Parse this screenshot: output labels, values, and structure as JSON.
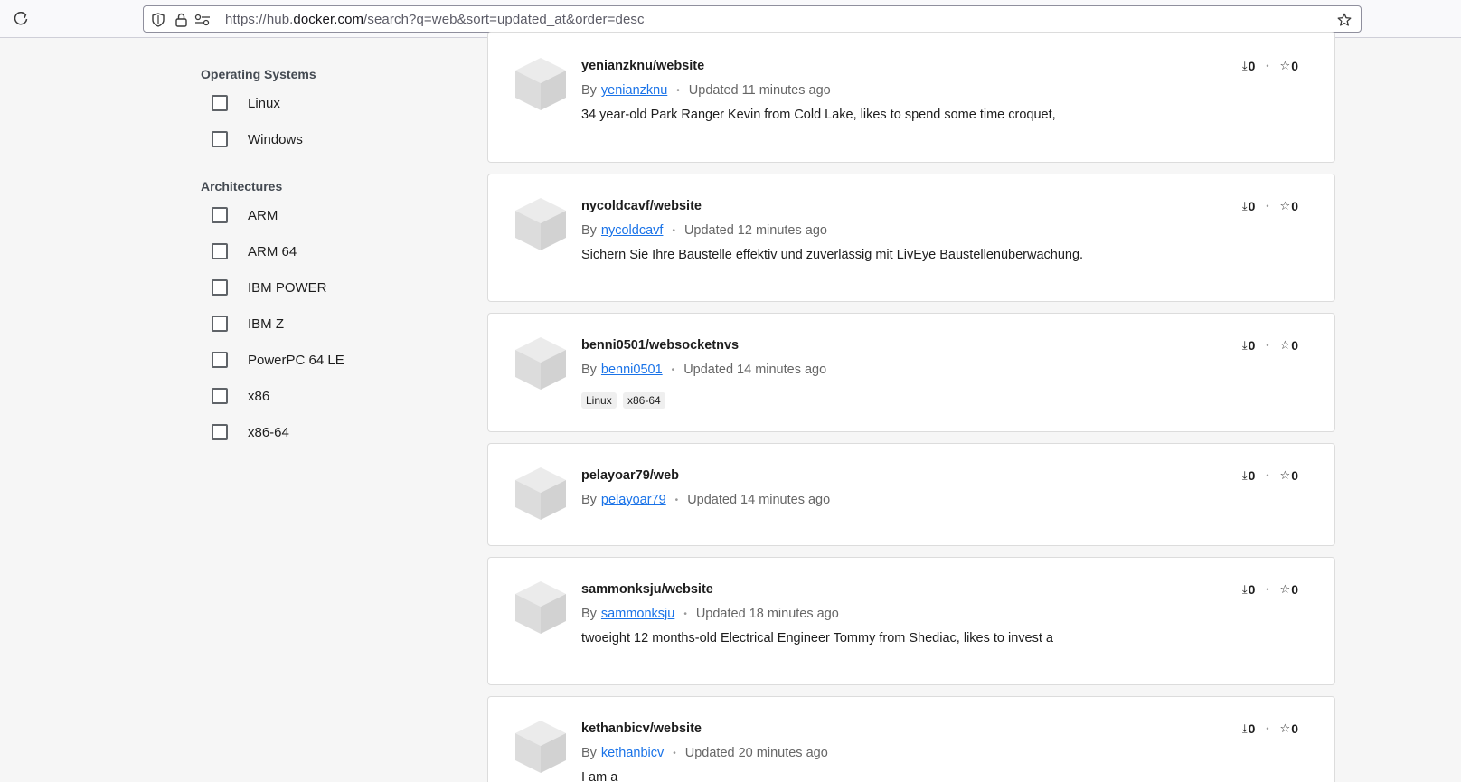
{
  "browser": {
    "url_prefix": "https://hub.",
    "url_host": "docker.com",
    "url_path": "/search?q=web&sort=updated_at&order=desc"
  },
  "filters": {
    "os_title": "Operating Systems",
    "os": [
      "Linux",
      "Windows"
    ],
    "arch_title": "Architectures",
    "arch": [
      "ARM",
      "ARM 64",
      "IBM POWER",
      "IBM Z",
      "PowerPC 64 LE",
      "x86",
      "x86-64"
    ]
  },
  "results": [
    {
      "name": "yenianzknu/website",
      "by_prefix": "By",
      "author": "yenianzknu",
      "updated": "Updated 11 minutes ago",
      "description": "34 year-old Park Ranger Kevin from Cold Lake, likes to spend some time croquet,",
      "downloads": "0",
      "stars": "0"
    },
    {
      "name": "nycoldcavf/website",
      "by_prefix": "By",
      "author": "nycoldcavf",
      "updated": "Updated 12 minutes ago",
      "description": "Sichern Sie Ihre Baustelle effektiv und zuverlässig mit LivEye Baustellenüberwachung.",
      "downloads": "0",
      "stars": "0"
    },
    {
      "name": "benni0501/websocketnvs",
      "by_prefix": "By",
      "author": "benni0501",
      "updated": "Updated 14 minutes ago",
      "tags": [
        "Linux",
        "x86-64"
      ],
      "downloads": "0",
      "stars": "0"
    },
    {
      "name": "pelayoar79/web",
      "by_prefix": "By",
      "author": "pelayoar79",
      "updated": "Updated 14 minutes ago",
      "downloads": "0",
      "stars": "0"
    },
    {
      "name": "sammonksju/website",
      "by_prefix": "By",
      "author": "sammonksju",
      "updated": "Updated 18 minutes ago",
      "description": "twoeight 12 months-old Electrical Engineer Tommy from Shediac, likes to invest a",
      "downloads": "0",
      "stars": "0"
    },
    {
      "name": "kethanbicv/website",
      "by_prefix": "By",
      "author": "kethanbicv",
      "updated": "Updated 20 minutes ago",
      "description": "I am a",
      "downloads": "0",
      "stars": "0"
    }
  ]
}
